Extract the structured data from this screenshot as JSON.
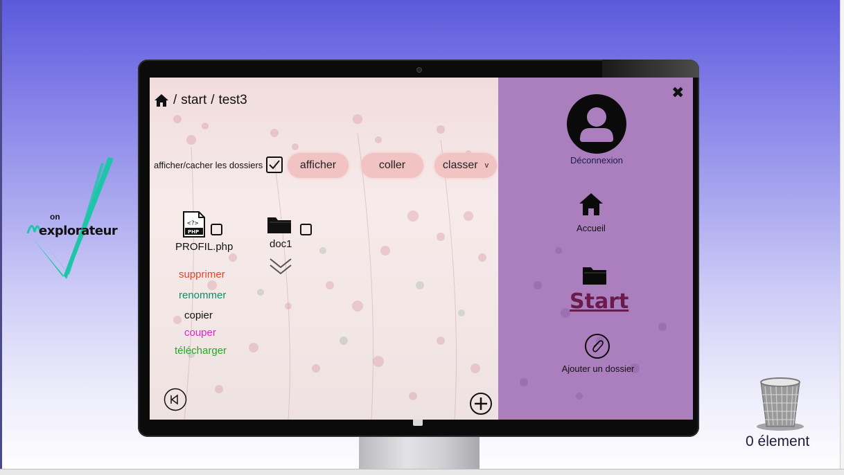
{
  "logo": {
    "on": "on",
    "explorateur": "explorateur"
  },
  "breadcrumb": {
    "sep1": "/",
    "item1": "start",
    "sep2": "/",
    "item2": "test3"
  },
  "toolbar": {
    "toggle_label": "afficher/cacher les dossiers",
    "toggle_checked": true,
    "afficher": "afficher",
    "coller": "coller",
    "classer": "classer",
    "classer_arrow": "v"
  },
  "files": [
    {
      "name": "PROFIL.php",
      "icon": "php-file-icon",
      "checked": false
    },
    {
      "name": "doc1",
      "icon": "folder-icon",
      "checked": false
    }
  ],
  "file_actions": [
    {
      "label": "supprimer",
      "color": "#e4442a"
    },
    {
      "label": "renommer",
      "color": "#0f8a6a"
    },
    {
      "label": "copier",
      "color": "#111111"
    },
    {
      "label": "couper",
      "color": "#e322c8"
    },
    {
      "label": "télécharger",
      "color": "#27a52b"
    }
  ],
  "sidebar": {
    "logout": "Déconnexion",
    "home": "Accueil",
    "start": "Start",
    "add_folder": "Ajouter un dossier"
  },
  "trash": {
    "count_label": "0 élement"
  },
  "colors": {
    "accent_purple": "#ab7fbe",
    "pill": "#f2c3c3",
    "start_link": "#6b1b4b"
  }
}
